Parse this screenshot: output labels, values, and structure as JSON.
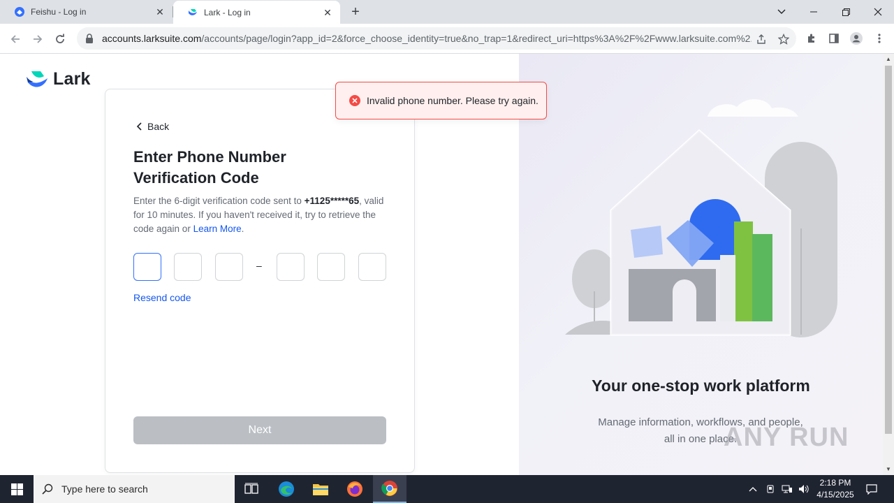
{
  "browser": {
    "tabs": [
      {
        "title": "Feishu - Log in",
        "active": false
      },
      {
        "title": "Lark - Log in",
        "active": true
      }
    ],
    "url_host": "accounts.larksuite.com",
    "url_path": "/accounts/page/login?app_id=2&force_choose_identity=true&no_trap=1&redirect_uri=https%3A%2F%2Fwww.larksuite.com%2..."
  },
  "page": {
    "logo_text": "Lark",
    "back_label": "Back",
    "heading_line1": "Enter Phone Number",
    "heading_line2": "Verification Code",
    "desc_prefix": "Enter the 6-digit verification code sent to",
    "phone_masked": "+1125*****65",
    "desc_middle": ", valid for 10 minutes. If you haven't received it, try to retrieve the code again or ",
    "learn_more": "Learn More",
    "desc_suffix": ".",
    "code_dash": "–",
    "resend_label": "Resend code",
    "next_label": "Next",
    "toast_message": "Invalid phone number. Please try again.",
    "promo_title": "Your one-stop work platform",
    "promo_subtitle": "Manage information, workflows, and people, all in one place."
  },
  "watermark": "ANY RUN",
  "taskbar": {
    "search_placeholder": "Type here to search",
    "time": "2:18 PM",
    "date": "4/15/2025"
  },
  "colors": {
    "accent": "#3370ff",
    "link": "#1456f0",
    "error": "#f54a45",
    "button_disabled": "#bbbfc4"
  }
}
